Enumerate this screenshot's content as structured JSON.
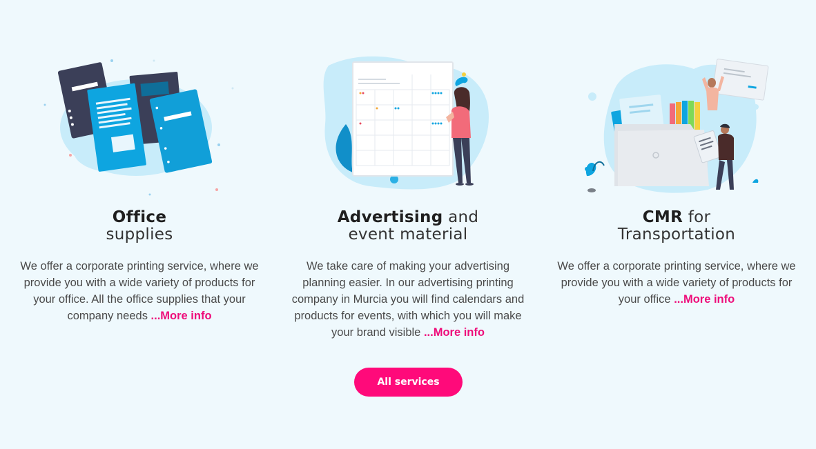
{
  "colors": {
    "background": "#eff9fd",
    "accent": "#ff0a7a",
    "link": "#ee0d7a",
    "blob": "#c8ecfa",
    "folder_dark": "#3b3f58",
    "folder_blue": "#0ea5e0"
  },
  "services": [
    {
      "icon": "office-supplies-illustration",
      "title_strong": "Office",
      "title_light": "supplies",
      "description": "We offer a corporate printing service, where we provide you with a wide variety of products for your office. All the office supplies that your company needs",
      "more_label": "...More info"
    },
    {
      "icon": "advertising-calendar-illustration",
      "title_strong": "Advertising",
      "title_light_inline": "and",
      "title_light": "event material",
      "description": "We take care of making your advertising planning easier. In our advertising printing company in Murcia you will find calendars and products for events, with which you will make your brand visible",
      "more_label": "...More info"
    },
    {
      "icon": "cmr-transport-illustration",
      "title_strong": "CMR",
      "title_light_inline": "for",
      "title_light": "Transportation",
      "description": "We offer a corporate printing service, where we provide you with a wide variety of products for your office",
      "more_label": "...More info"
    }
  ],
  "cta": {
    "label": "All services"
  }
}
